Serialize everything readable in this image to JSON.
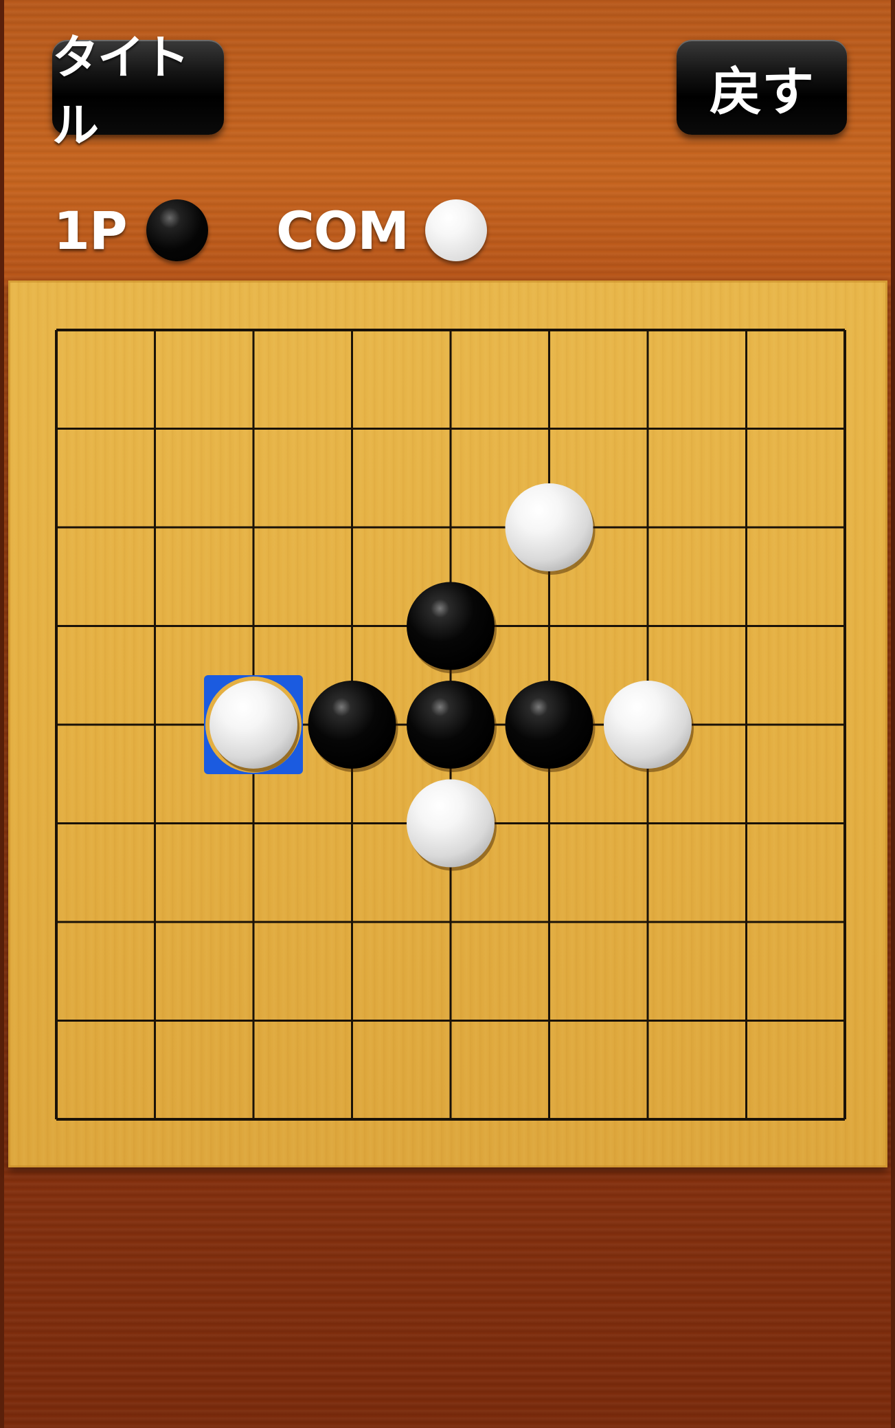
{
  "header": {
    "title_button_label": "タイトル",
    "back_button_label": "戻す"
  },
  "players": {
    "player1_label": "1P",
    "player1_stone": "black",
    "player2_label": "COM",
    "player2_stone": "white"
  },
  "board": {
    "grid_lines": 9,
    "stones": [
      {
        "col": 5,
        "row": 2,
        "color": "white"
      },
      {
        "col": 4,
        "row": 3,
        "color": "black"
      },
      {
        "col": 2,
        "row": 4,
        "color": "white",
        "last_move": true
      },
      {
        "col": 3,
        "row": 4,
        "color": "black"
      },
      {
        "col": 4,
        "row": 4,
        "color": "black"
      },
      {
        "col": 5,
        "row": 4,
        "color": "black"
      },
      {
        "col": 6,
        "row": 4,
        "color": "white"
      },
      {
        "col": 4,
        "row": 5,
        "color": "white"
      }
    ]
  },
  "colors": {
    "board_wood": "#e4af42",
    "background_wood": "#9c3f10",
    "last_move_marker": "#1b5be0",
    "grid_line": "#1a1208"
  }
}
